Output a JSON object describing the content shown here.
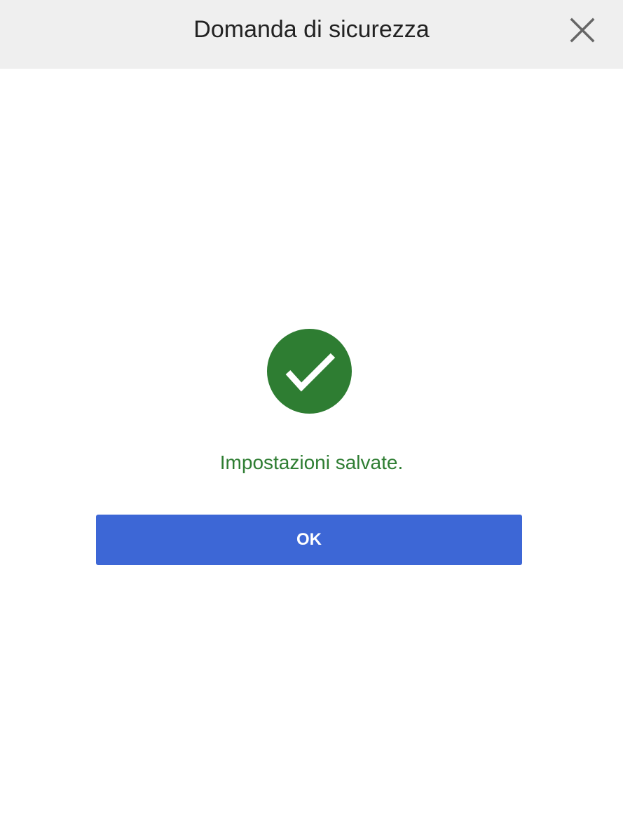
{
  "dialog": {
    "title": "Domanda di sicurezza",
    "close_icon": "close-icon",
    "status_icon": "check-circle-icon",
    "message": "Impostazioni salvate.",
    "ok_label": "OK"
  },
  "colors": {
    "header_background": "#efefef",
    "success_green": "#2e7d32",
    "button_blue": "#3d67d6",
    "close_icon_gray": "#666666"
  }
}
